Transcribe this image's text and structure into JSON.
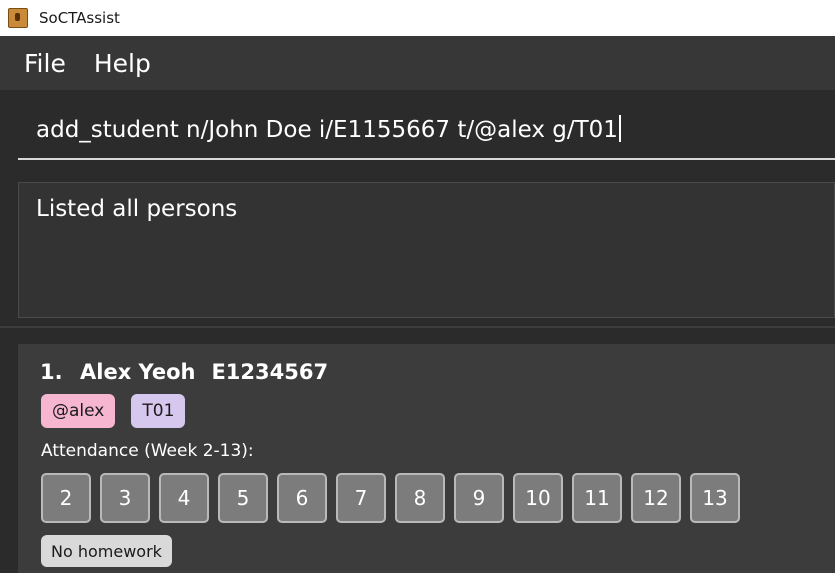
{
  "window": {
    "title": "SoCTAssist"
  },
  "menu": {
    "file": "File",
    "help": "Help"
  },
  "command_box": {
    "value": "add_student n/John Doe i/E1155667 t/@alex g/T01"
  },
  "result_display": {
    "text": "Listed all persons"
  },
  "students": [
    {
      "index": "1.",
      "name": "Alex Yeoh",
      "student_id": "E1234567",
      "telegram": "@alex",
      "group": "T01",
      "attendance_label": "Attendance (Week 2-13):",
      "weeks": [
        "2",
        "3",
        "4",
        "5",
        "6",
        "7",
        "8",
        "9",
        "10",
        "11",
        "12",
        "13"
      ],
      "homework_status": "No homework"
    }
  ],
  "colors": {
    "telegram_tag": "#f6b6cf",
    "group_tag": "#d5c7ee",
    "week_box": "#7c7c7c",
    "homework_badge": "#d9d9d9"
  }
}
